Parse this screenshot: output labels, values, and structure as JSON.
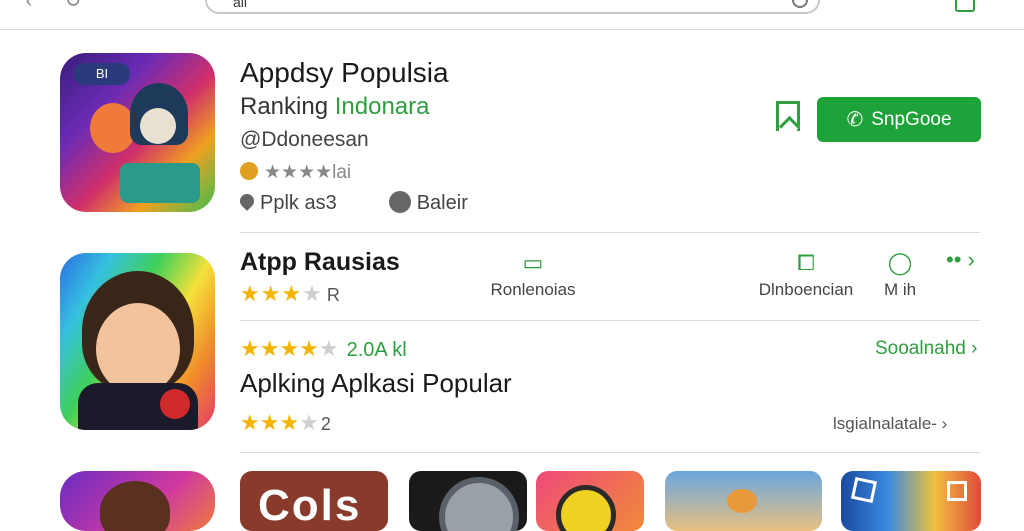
{
  "browser": {
    "url_text": "all"
  },
  "featured_app": {
    "title": "Appdsy Populsia",
    "subtitle_prefix": "Ranking ",
    "subtitle_accent": "Indonara",
    "developer": "@Ddoneesan",
    "rating_text": "★★★★lai",
    "meta_left": "Pplk as3",
    "meta_right": "Baleir",
    "install_label": "SnpGooe",
    "icon_label": "BI"
  },
  "second_app": {
    "title": "Atpp Rausias",
    "stars_filled": 3,
    "stars_tail": "R",
    "actions": [
      {
        "label": "Ronlenoias",
        "glyph": "▭"
      },
      {
        "label": "Dlnboencian",
        "glyph": "⧠"
      },
      {
        "label": "M ih",
        "glyph": "◯"
      }
    ],
    "more_glyph": "•• ›",
    "rating_value": "2.0A kl",
    "rating_stars_filled": 4,
    "link_green": "Sooalnahd ›"
  },
  "section": {
    "title": "Aplking Aplkasi Popular",
    "stars_filled": 3,
    "stars_tail": "2",
    "link_gray": "lsgialnalatale- ›"
  },
  "tiles": [
    {
      "text": "Cols"
    }
  ],
  "colors": {
    "accent_green": "#2e9e3e",
    "install_green": "#1ea33a",
    "star_gold": "#f4b400"
  }
}
